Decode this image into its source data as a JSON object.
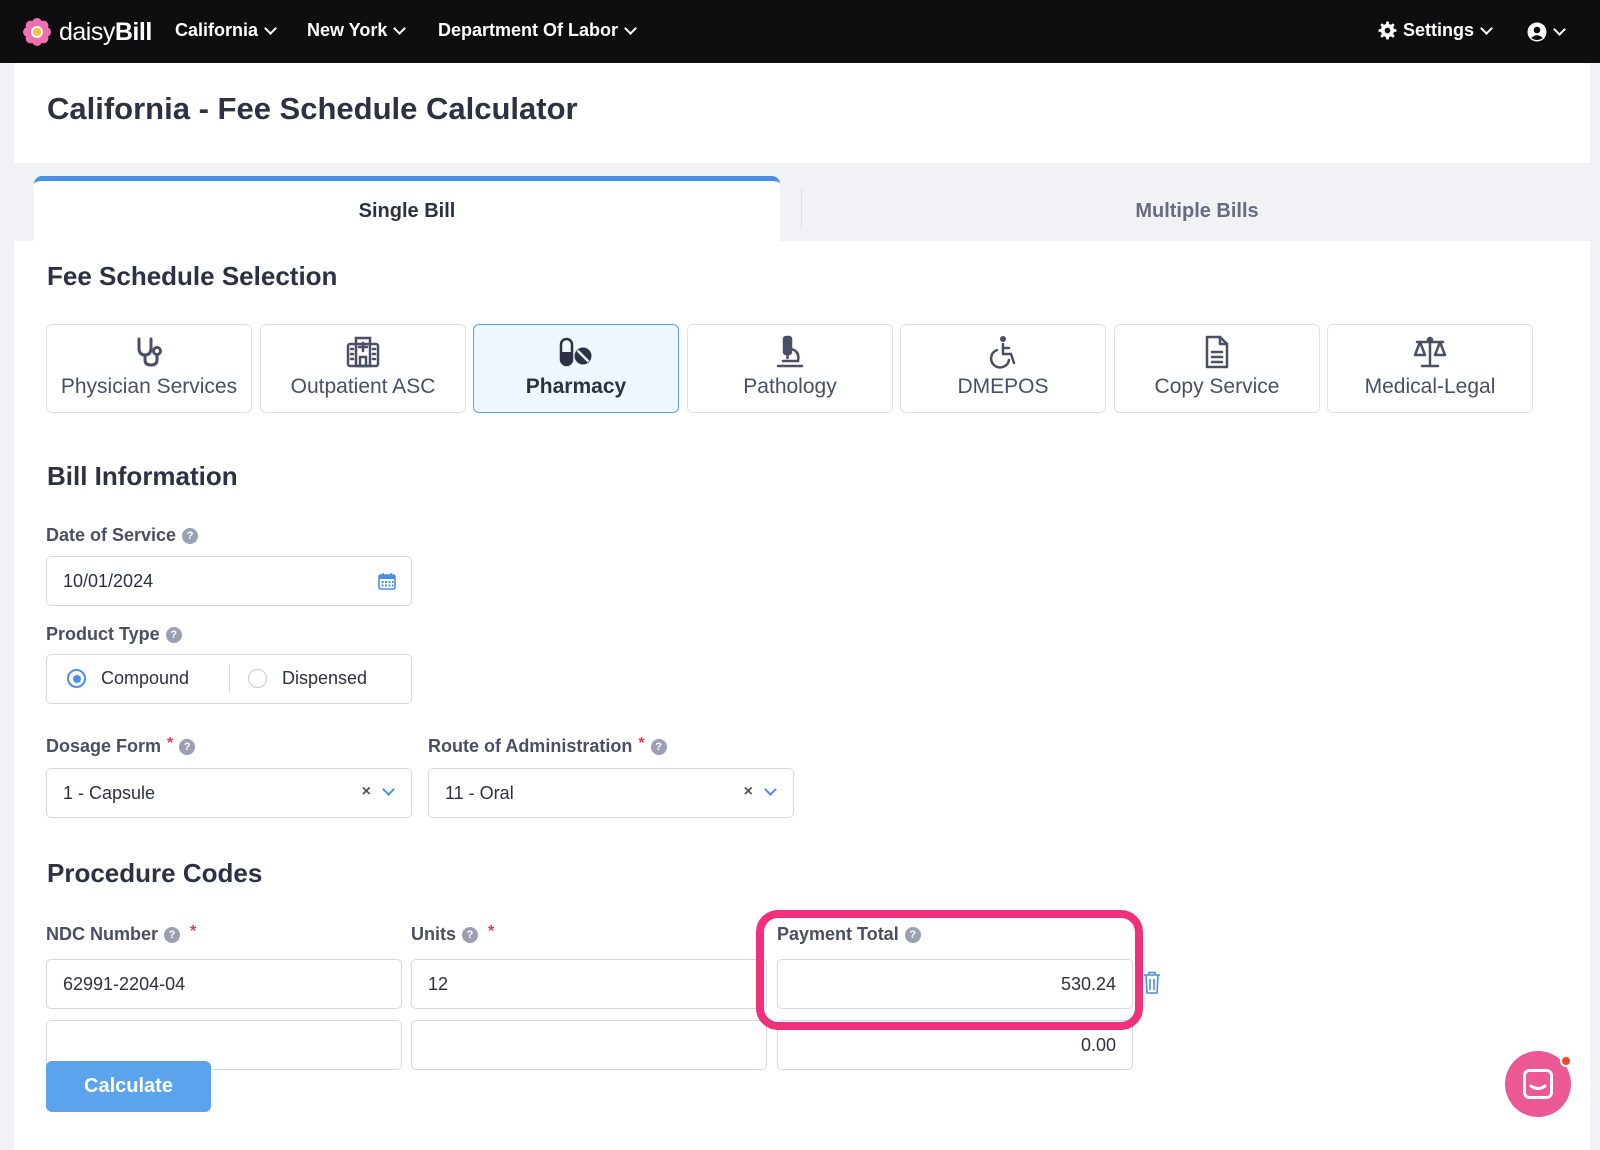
{
  "brand": {
    "name_light": "daisy",
    "name_bold": "Bill"
  },
  "nav": {
    "items": [
      {
        "label": "California"
      },
      {
        "label": "New York"
      },
      {
        "label": "Department Of Labor"
      }
    ],
    "settings_label": "Settings"
  },
  "page": {
    "title": "California - Fee Schedule Calculator"
  },
  "tabs": [
    {
      "label": "Single Bill",
      "active": true
    },
    {
      "label": "Multiple Bills",
      "active": false
    }
  ],
  "fee_schedule": {
    "title": "Fee Schedule Selection",
    "options": [
      {
        "label": "Physician Services",
        "icon": "stethoscope-icon"
      },
      {
        "label": "Outpatient ASC",
        "icon": "hospital-icon"
      },
      {
        "label": "Pharmacy",
        "icon": "pills-icon",
        "selected": true
      },
      {
        "label": "Pathology",
        "icon": "microscope-icon"
      },
      {
        "label": "DMEPOS",
        "icon": "wheelchair-icon"
      },
      {
        "label": "Copy Service",
        "icon": "document-icon"
      },
      {
        "label": "Medical-Legal",
        "icon": "balance-scale-icon"
      }
    ]
  },
  "bill_info": {
    "title": "Bill Information",
    "date_of_service": {
      "label": "Date of Service",
      "value": "10/01/2024"
    },
    "product_type": {
      "label": "Product Type",
      "options": [
        "Compound",
        "Dispensed"
      ],
      "selected": "Compound"
    },
    "dosage_form": {
      "label": "Dosage Form",
      "required_mark": "*",
      "value": "1 - Capsule",
      "clear": "×"
    },
    "route": {
      "label": "Route of Administration",
      "required_mark": "*",
      "value": "11 - Oral",
      "clear": "×"
    }
  },
  "procedure_codes": {
    "title": "Procedure Codes",
    "columns": {
      "ndc": "NDC Number",
      "units": "Units",
      "payment_total": "Payment Total"
    },
    "required_mark": "*",
    "rows": [
      {
        "ndc": "62991-2204-04",
        "units": "12",
        "payment_total": "530.24"
      },
      {
        "ndc": "",
        "units": "",
        "payment_total": "0.00"
      }
    ]
  },
  "actions": {
    "calculate_label": "Calculate"
  },
  "help_glyph": "?",
  "colors": {
    "accent": "#4a90e2",
    "highlight": "#f0307a",
    "nav_bg": "#0e0e10",
    "button": "#5ba3ec"
  }
}
